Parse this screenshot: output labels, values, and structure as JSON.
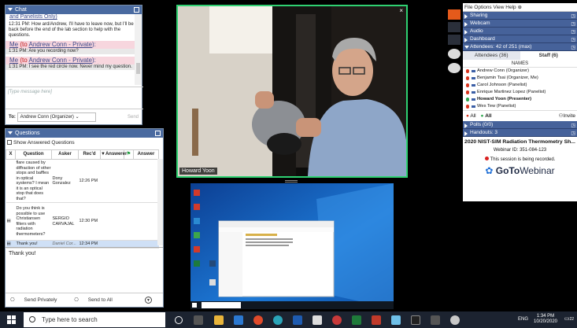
{
  "chat": {
    "header": "Chat",
    "partial_top": "and Panelists Only)",
    "messages": [
      {
        "head": null,
        "body": "12:31 PM: How ard/Andrew, I'll have to leave now, but I'll be back  before the end of the lab section to help with the questions.",
        "pink": false
      },
      {
        "head_me": "Me",
        "head_to": "(to",
        "head_name": "Andrew Conn - Private",
        "head_close": "):",
        "body": "1:31 PM: Are you recording now?",
        "pink": true
      },
      {
        "head_me": "Me",
        "head_to": "(to",
        "head_name": "Andrew Conn - Private",
        "head_close": "):",
        "body": "1:31 PM: I see the red circle now.  Never mind my question.",
        "pink": true
      }
    ],
    "input_placeholder": "[Type message here]",
    "to_label": "To:",
    "to_value": "Andrew Conn (Organizer)",
    "send_label": "Send"
  },
  "questions": {
    "header": "Questions",
    "show_answered": "Show Answered Questions",
    "columns": [
      "X",
      "Question",
      "Asker",
      "Rec'd",
      "Answerer",
      "",
      "Answer"
    ],
    "rows": [
      {
        "question": "flare caused by diffraction of other stops and baffles in optical systems? I mean it is an optical stop that does that?",
        "asker": "Dony Gonzalez",
        "recd": "12:26 PM"
      },
      {
        "question": "Do you think is possible to use Christiansen filters with radiation thermometers?",
        "asker": "SERGIO CARVAJAL",
        "recd": "12:30 PM"
      },
      {
        "question": "Thank you!",
        "asker": "Daniel Cor...",
        "recd": "12:34 PM"
      }
    ],
    "answer_text": "Thank you!",
    "send_private": "Send Privately",
    "send_all": "Send to All"
  },
  "video": {
    "presenter_label": "Howard Yoon",
    "close": "×"
  },
  "control_panel": {
    "menu": "File  Options  View  Help",
    "panels_top": [
      {
        "label": "Sharing"
      },
      {
        "label": "Webcam"
      },
      {
        "label": "Audio"
      },
      {
        "label": "Dashboard"
      }
    ],
    "attendees_header": "Attendees: 42 of 251 (max)",
    "tabs": [
      "Attendees (36)",
      "Staff (6)"
    ],
    "names_header": "NAMES",
    "staff": [
      {
        "name": "Andrew Conn (Organizer)",
        "bold": false
      },
      {
        "name": "Benjamin Tsai (Organizer, Me)",
        "bold": false
      },
      {
        "name": "Carol Johnson (Panelist)",
        "bold": false
      },
      {
        "name": "Enrique Martinez Lopez (Panelist)",
        "bold": false
      },
      {
        "name": "Howard Yoon (Presenter)",
        "bold": true
      },
      {
        "name": "Wes Tew (Panelist)",
        "bold": false
      }
    ],
    "all_label": "All",
    "all_label2": "All",
    "invite_label": "Invite",
    "polls": "Polls (0/0)",
    "handouts": "Handouts: 3",
    "webinar_title": "2020 NIST-SIM Radiation Thermometry Sh...",
    "webinar_id": "Webinar ID: 351-084-123",
    "recording_note": "This session is being recorded.",
    "logo_pre": "GoTo",
    "logo_post": "Webinar"
  },
  "taskbar": {
    "search_placeholder": "Type here to search",
    "lang": "ENG",
    "time": "1:34 PM",
    "date": "10/20/2020",
    "notif_count": "22"
  }
}
